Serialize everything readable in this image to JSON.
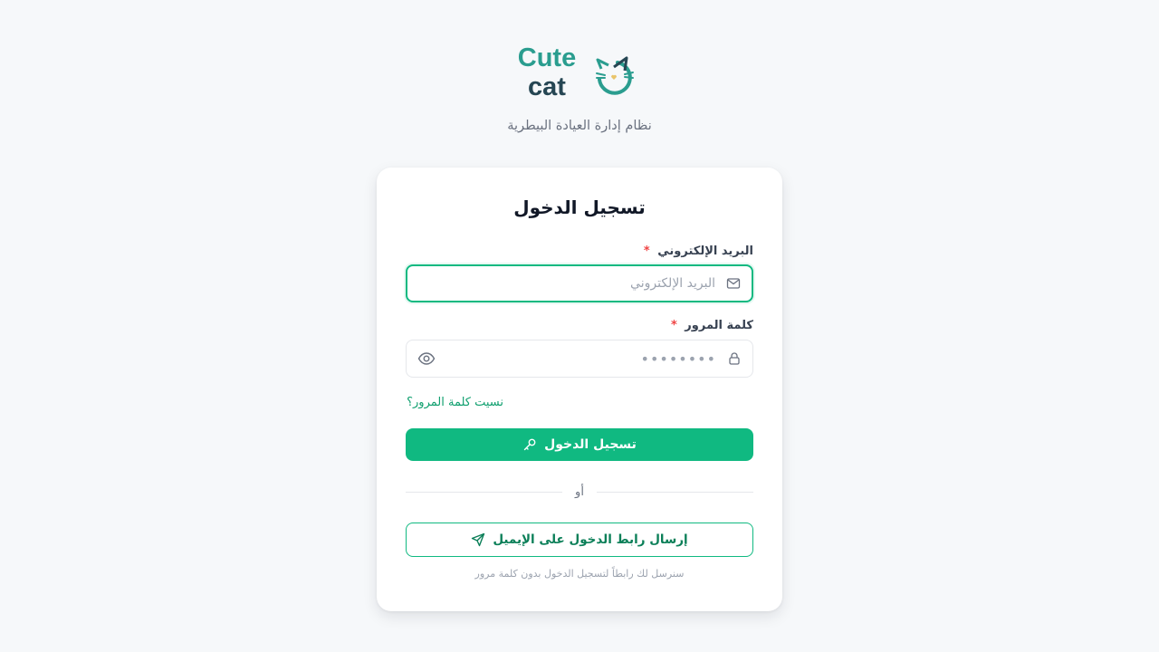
{
  "brand": {
    "word1": "Cute",
    "word2": "cat",
    "logo_icon": "cat-face-icon",
    "colors": {
      "teal": "#2a9d8f",
      "dark": "#264653",
      "heart": "#e9c46a"
    }
  },
  "subtitle": "نظام إدارة العيادة البيطرية",
  "login_card": {
    "title": "تسجيل الدخول",
    "email": {
      "label": "البريد الإلكتروني",
      "required_mark": "*",
      "placeholder": "البريد الإلكتروني",
      "value": "",
      "icon": "mail-icon"
    },
    "password": {
      "label": "كلمة المرور",
      "required_mark": "*",
      "masked_value": "••••••••",
      "icon": "lock-icon",
      "toggle_icon": "eye-icon"
    },
    "forgot_link": "نسيت كلمة المرور؟",
    "login_button": {
      "label": "تسجيل الدخول",
      "icon": "key-icon"
    },
    "divider_text": "أو",
    "magic_link_button": {
      "label": "إرسال رابط الدخول على الإيميل",
      "icon": "send-icon"
    },
    "helper_text": "سنرسل لك رابطاً لتسجيل الدخول بدون كلمة مرور"
  },
  "theme": {
    "accent": "#10b981",
    "required": "#ef4444",
    "background": "#f6f8fa"
  }
}
